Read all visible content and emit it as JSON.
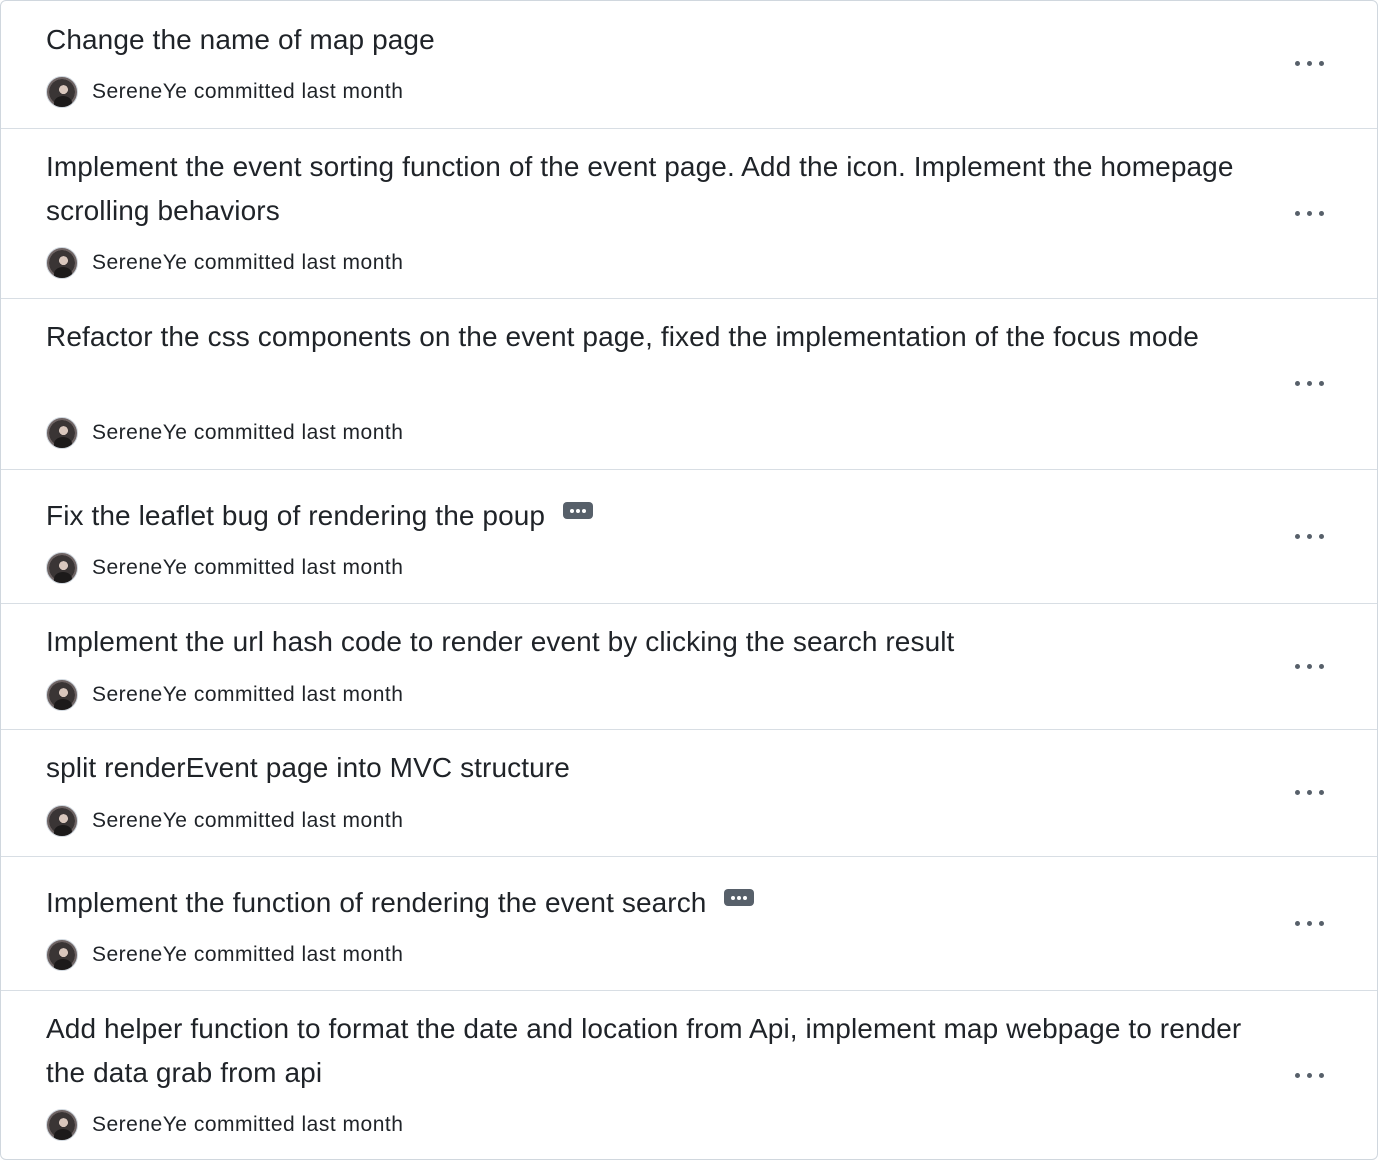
{
  "commits": [
    {
      "title": "Change the name of map page",
      "author": "SereneYe",
      "meta": "committed last month",
      "has_description": false
    },
    {
      "title": "Implement the event sorting function of the event page. Add the icon. Implement the homepage scrolling behaviors",
      "author": "SereneYe",
      "meta": "committed last month",
      "has_description": false
    },
    {
      "title": "Refactor the css components on the event page, fixed the implementation of the focus mode",
      "author": "SereneYe",
      "meta": "committed last month",
      "has_description": false
    },
    {
      "title": "Fix the leaflet bug of rendering the poup",
      "author": "SereneYe",
      "meta": "committed last month",
      "has_description": true
    },
    {
      "title": "Implement the url hash code to render event by clicking the search result",
      "author": "SereneYe",
      "meta": "committed last month",
      "has_description": false
    },
    {
      "title": "split renderEvent page into MVC structure",
      "author": "SereneYe",
      "meta": "committed last month",
      "has_description": false
    },
    {
      "title": "Implement the function of rendering the event search",
      "author": "SereneYe",
      "meta": "committed last month",
      "has_description": true
    },
    {
      "title": "Add helper function to format the date and location from Api, implement map webpage to render the data grab from api",
      "author": "SereneYe",
      "meta": "committed last month",
      "has_description": false
    }
  ],
  "colors": {
    "text": "#1f2328",
    "muted": "#57606a",
    "border": "#d0d7de"
  },
  "icons": {
    "expand_description": "ellipsis-badge-icon",
    "row_menu": "kebab-horizontal-icon",
    "avatar": "user-avatar"
  }
}
